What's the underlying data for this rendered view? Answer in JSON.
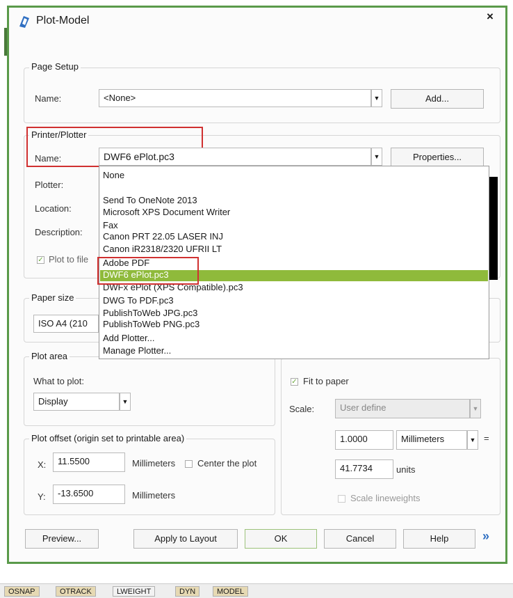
{
  "window": {
    "title": "Plot-Model",
    "close": "×"
  },
  "page_setup": {
    "group": "Page Setup",
    "name_label": "Name:",
    "name_value": "<None>",
    "add_button": "Add..."
  },
  "printer": {
    "group": "Printer/Plotter",
    "name_label": "Name:",
    "name_value": "DWF6 ePlot.pc3",
    "properties_button": "Properties...",
    "plotter_label": "Plotter:",
    "location_label": "Location:",
    "description_label": "Description:",
    "plot_to_file_label": "Plot to file",
    "dropdown_items": [
      "None",
      "Send To OneNote 2013",
      "Microsoft XPS Document Writer",
      "Fax",
      "Canon PRT 22.05 LASER INJ",
      "Canon iR2318/2320 UFRII LT",
      "Adobe PDF",
      "DWF6 ePlot.pc3",
      "DWFx ePlot (XPS Compatible).pc3",
      "DWG To PDF.pc3",
      "PublishToWeb JPG.pc3",
      "PublishToWeb PNG.pc3",
      "Add Plotter...",
      "Manage Plotter..."
    ]
  },
  "paper_size": {
    "group": "Paper size",
    "value": "ISO A4 (210"
  },
  "plot_area": {
    "group": "Plot area",
    "what_label": "What to plot:",
    "what_value": "Display"
  },
  "plot_scale": {
    "fit_label": "Fit to paper",
    "scale_label": "Scale:",
    "scale_value": "User define",
    "value1": "1.0000",
    "unit1": "Millimeters",
    "equals": "=",
    "value2": "41.7734",
    "unit2": "units",
    "lineweights_label": "Scale lineweights"
  },
  "plot_offset": {
    "group": "Plot offset (origin set to printable area)",
    "x_label": "X:",
    "x_value": "11.5500",
    "x_unit": "Millimeters",
    "center_label": "Center the plot",
    "y_label": "Y:",
    "y_value": "-13.6500",
    "y_unit": "Millimeters"
  },
  "buttons": {
    "preview": "Preview...",
    "apply": "Apply to Layout",
    "ok": "OK",
    "cancel": "Cancel",
    "help": "Help",
    "expand": "»"
  },
  "statusbar": [
    "OSNAP",
    "OTRACK",
    "LWEIGHT",
    "DYN",
    "MODEL"
  ]
}
